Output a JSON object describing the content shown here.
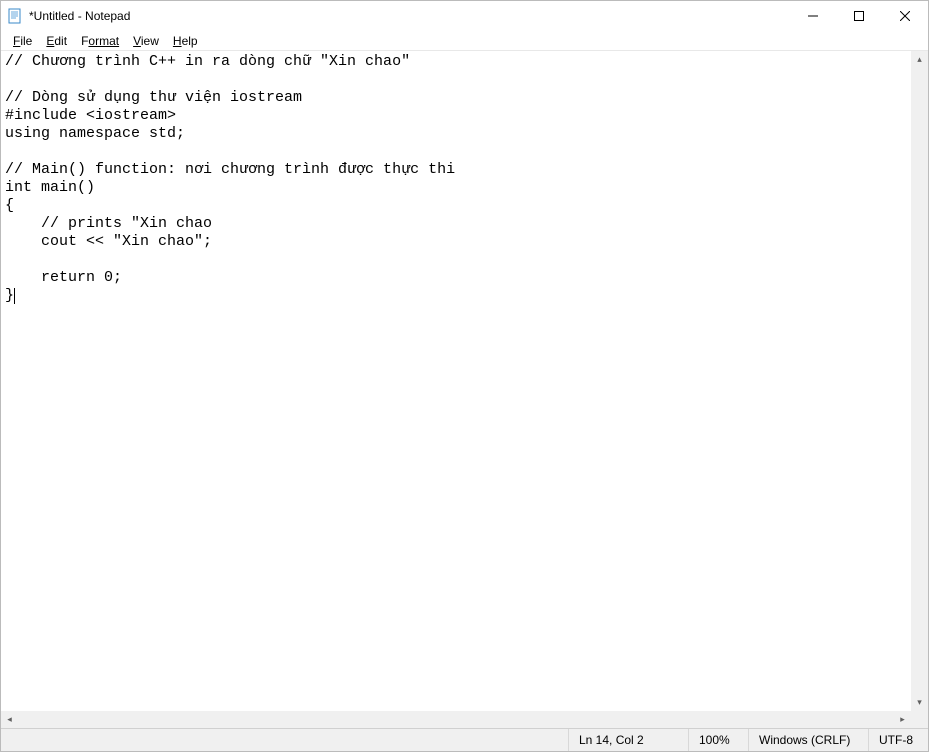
{
  "titlebar": {
    "title": "*Untitled - Notepad"
  },
  "menu": {
    "file": "ile",
    "edit": "dit",
    "format": "ormat",
    "view": "iew",
    "help": "elp"
  },
  "editor": {
    "content": "// Chương trình C++ in ra dòng chữ \"Xin chao\"\n\n// Dòng sử dụng thư viện iostream\n#include <iostream>\nusing namespace std;\n\n// Main() function: nơi chương trình được thực thi\nint main()\n{\n    // prints \"Xin chao\n    cout << \"Xin chao\";\n\n    return 0;\n}"
  },
  "status": {
    "position": "Ln 14, Col 2",
    "zoom": "100%",
    "line_ending": "Windows (CRLF)",
    "encoding": "UTF-8"
  }
}
